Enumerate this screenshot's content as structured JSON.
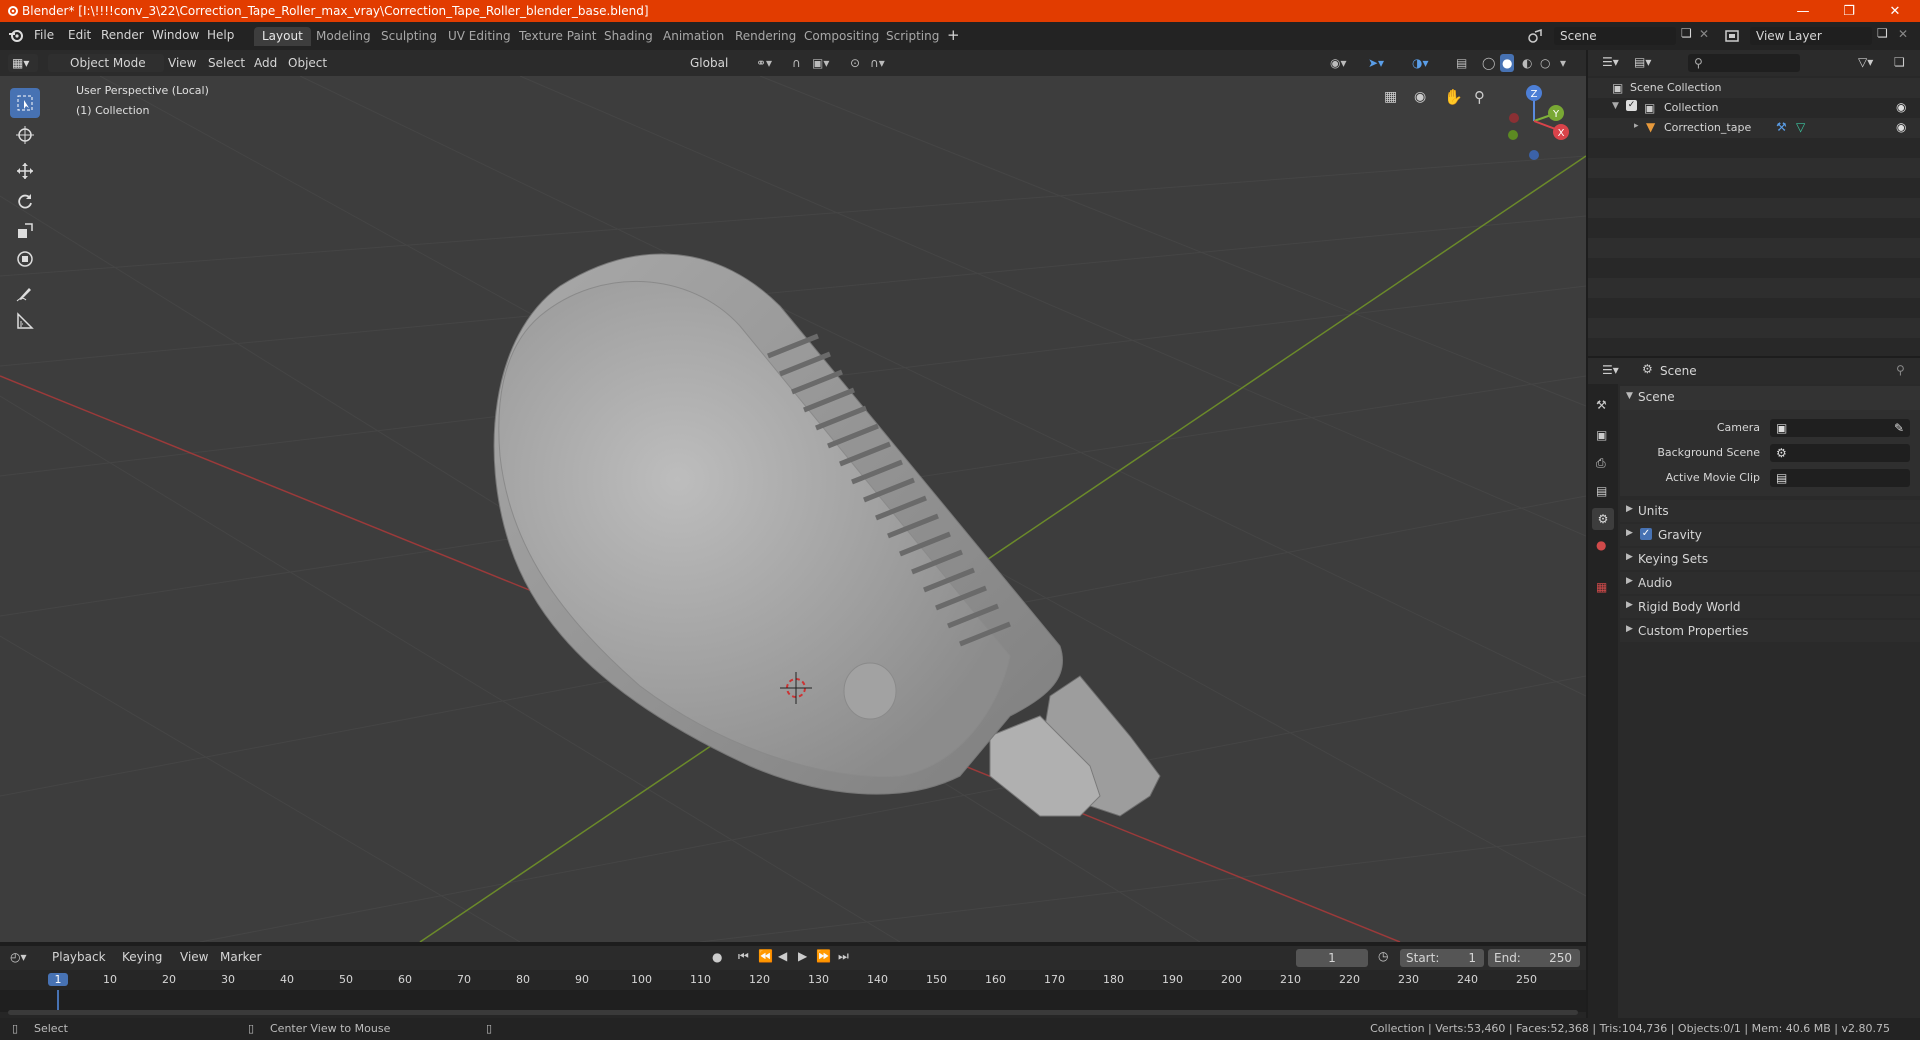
{
  "window": {
    "title": "Blender* [I:\\!!!!conv_3\\22\\Correction_Tape_Roller_max_vray\\Correction_Tape_Roller_blender_base.blend]",
    "accent": "#e23c00"
  },
  "menu": [
    "File",
    "Edit",
    "Render",
    "Window",
    "Help"
  ],
  "workspaces": [
    "Layout",
    "Modeling",
    "Sculpting",
    "UV Editing",
    "Texture Paint",
    "Shading",
    "Animation",
    "Rendering",
    "Compositing",
    "Scripting"
  ],
  "active_workspace": "Layout",
  "scene_field": "Scene",
  "view_layer_field": "View Layer",
  "viewport_header": {
    "mode": "Object Mode",
    "menus": [
      "View",
      "Select",
      "Add",
      "Object"
    ],
    "orientation": "Global"
  },
  "viewport": {
    "overlay_line1": "User Perspective (Local)",
    "overlay_line2": "(1) Collection",
    "gizmo_axes": [
      "Z",
      "Y",
      "X"
    ]
  },
  "outliner": {
    "root": "Scene Collection",
    "collection": "Collection",
    "object": "Correction_tape"
  },
  "properties": {
    "header": "Scene",
    "section": "Scene",
    "fields": [
      {
        "label": "Camera"
      },
      {
        "label": "Background Scene"
      },
      {
        "label": "Active Movie Clip"
      }
    ],
    "panels": [
      "Units",
      "Gravity",
      "Keying Sets",
      "Audio",
      "Rigid Body World",
      "Custom Properties"
    ],
    "gravity_checked": true
  },
  "timeline": {
    "menus": [
      "Playback",
      "Keying",
      "View",
      "Marker"
    ],
    "current_frame": "1",
    "start_label": "Start:",
    "start": "1",
    "end_label": "End:",
    "end": "250",
    "ticks": [
      "1",
      "10",
      "20",
      "30",
      "40",
      "50",
      "60",
      "70",
      "80",
      "90",
      "100",
      "110",
      "120",
      "130",
      "140",
      "150",
      "160",
      "170",
      "180",
      "190",
      "200",
      "210",
      "220",
      "230",
      "240",
      "250"
    ]
  },
  "statusbar": {
    "left": "Select",
    "middle": "Center View to Mouse",
    "right": "Collection | Verts:53,460 | Faces:52,368 | Tris:104,736 | Objects:0/1 | Mem: 40.6 MB | v2.80.75"
  }
}
